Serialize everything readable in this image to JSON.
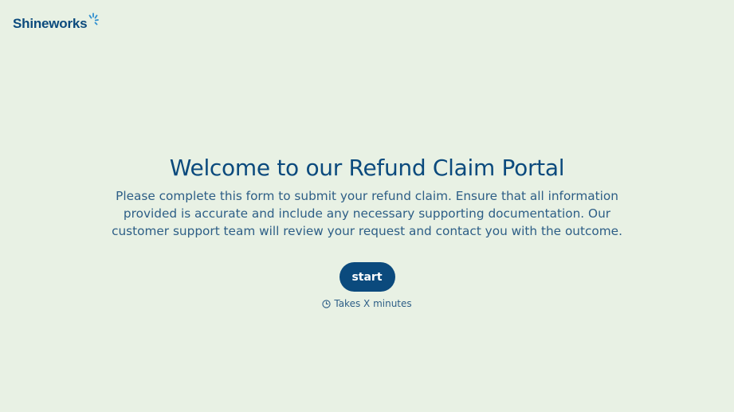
{
  "brand": {
    "name": "Shineworks",
    "color": "#0b4a7d",
    "background": "#e8f1e4"
  },
  "hero": {
    "title": "Welcome to our Refund Claim Portal",
    "description": "Please complete this form to submit your refund claim. Ensure that all information provided is accurate and include any necessary supporting documentation. Our customer support team will review your request and contact you with the outcome."
  },
  "actions": {
    "start_label": "start",
    "duration_text": "Takes X minutes",
    "duration_icon": "clock-icon"
  }
}
